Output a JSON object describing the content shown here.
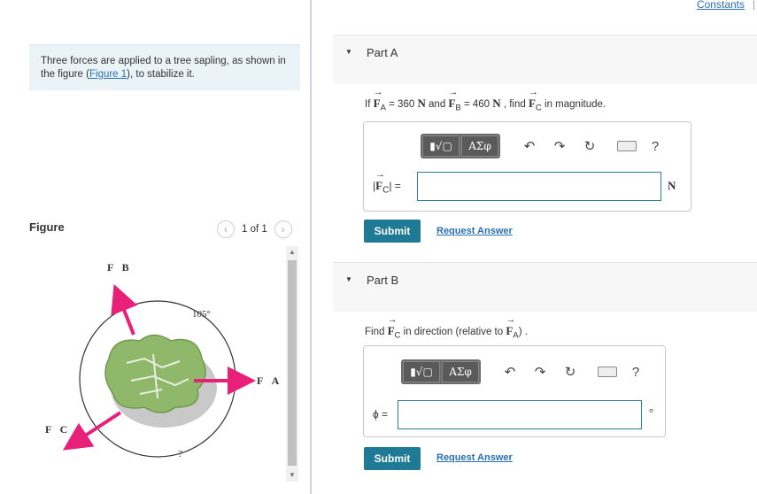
{
  "intro": {
    "text_before": "Three forces are applied to a tree sapling, as shown in the figure (",
    "link": "Figure 1",
    "text_after": "), to stabilize it."
  },
  "figure": {
    "title": "Figure",
    "pager": "1 of 1",
    "labels": {
      "fb": "F⃗B",
      "fa": "F⃗A",
      "fc": "F⃗C",
      "angle": "105°",
      "unknown": "?"
    }
  },
  "header": {
    "constants": "Constants",
    "sep": "|"
  },
  "partA": {
    "title": "Part A",
    "q_if": "If ",
    "fa": "F",
    "fa_sub": "A",
    "q_eq1": " = 360 ",
    "q_unit1": "N",
    "q_and": " and ",
    "fb": "F",
    "fb_sub": "B",
    "q_eq2": " = 460 ",
    "q_unit2": "N",
    "q_find": " , find ",
    "fc": "F",
    "fc_sub": "C",
    "q_end": " in magnitude.",
    "lhs_open": "|",
    "lhs_var": "F",
    "lhs_sub": "C",
    "lhs_close": "| =",
    "input_value": "",
    "unit": "N",
    "submit": "Submit",
    "request": "Request Answer"
  },
  "partB": {
    "title": "Part B",
    "q_find": "Find ",
    "fc": "F",
    "fc_sub": "C",
    "q_mid": " in direction (relative to ",
    "fa": "F",
    "fa_sub": "A",
    "q_end": ") .",
    "lhs": "ϕ =",
    "input_value": "",
    "unit": "°",
    "submit": "Submit",
    "request": "Request Answer"
  },
  "toolbar": {
    "matrix": "▮√▢",
    "greek": "ΑΣφ",
    "help": "?"
  },
  "colors": {
    "accent": "#1f7a96",
    "arrow": "#e8207a",
    "tree": "#8fb86a"
  }
}
